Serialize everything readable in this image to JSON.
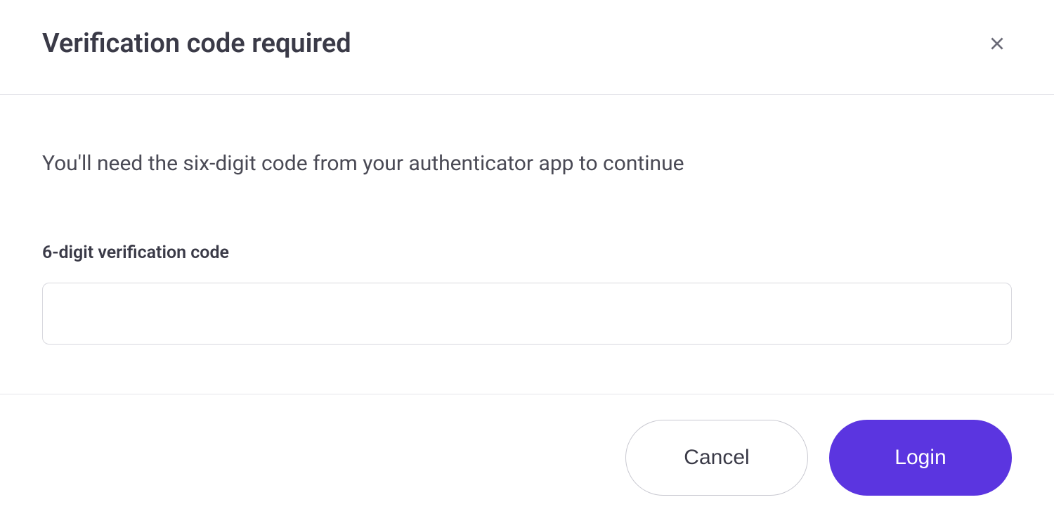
{
  "header": {
    "title": "Verification code required"
  },
  "body": {
    "description": "You'll need the six-digit code from your authenticator app to continue",
    "field_label": "6-digit verification code",
    "code_value": ""
  },
  "footer": {
    "cancel_label": "Cancel",
    "login_label": "Login"
  },
  "colors": {
    "primary": "#5b35e0",
    "text": "#3a3a47",
    "border": "#d8d8de"
  }
}
